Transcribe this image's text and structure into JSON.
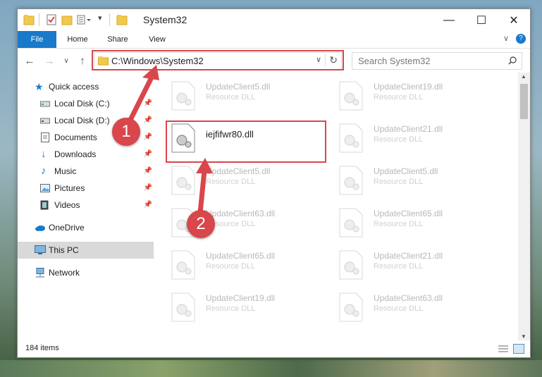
{
  "window": {
    "title": "System32",
    "controls": {
      "minimize": "—",
      "maximize": "☐",
      "close": "✕"
    }
  },
  "ribbon": {
    "tabs": [
      {
        "label": "File"
      },
      {
        "label": "Home"
      },
      {
        "label": "Share"
      },
      {
        "label": "View"
      }
    ]
  },
  "nav": {
    "address": "C:\\Windows\\System32",
    "search_placeholder": "Search System32"
  },
  "sidebar": {
    "items": [
      {
        "label": "Quick access",
        "icon": "star-icon"
      },
      {
        "label": "Local Disk (C:)",
        "icon": "drive-icon",
        "pinned": true
      },
      {
        "label": "Local Disk (D:)",
        "icon": "drive-icon",
        "pinned": true
      },
      {
        "label": "Documents",
        "icon": "documents-icon",
        "pinned": true
      },
      {
        "label": "Downloads",
        "icon": "downloads-icon",
        "pinned": true
      },
      {
        "label": "Music",
        "icon": "music-icon",
        "pinned": true
      },
      {
        "label": "Pictures",
        "icon": "pictures-icon",
        "pinned": true
      },
      {
        "label": "Videos",
        "icon": "videos-icon",
        "pinned": true
      },
      {
        "label": "OneDrive",
        "icon": "cloud-icon"
      },
      {
        "label": "This PC",
        "icon": "computer-icon",
        "selected": true
      },
      {
        "label": "Network",
        "icon": "network-icon"
      }
    ]
  },
  "files": {
    "type_label": "Resource DLL",
    "highlighted": "iejfifwr80.dll",
    "left_column": [
      "UpdateClient5.dll",
      "UpdateClient5.dll",
      "UpdateClient63.dll",
      "UpdateClient65.dll",
      "UpdateClient19.dll"
    ],
    "right_column": [
      "UpdateClient19.dll",
      "UpdateClient21.dll",
      "UpdateClient5.dll",
      "UpdateClient65.dll",
      "UpdateClient21.dll",
      "UpdateClient63.dll"
    ]
  },
  "status": {
    "item_count": "184 items"
  },
  "annotations": {
    "step1": "1",
    "step2": "2"
  },
  "colors": {
    "accent": "#1979ca",
    "annotation": "#d9464b"
  }
}
